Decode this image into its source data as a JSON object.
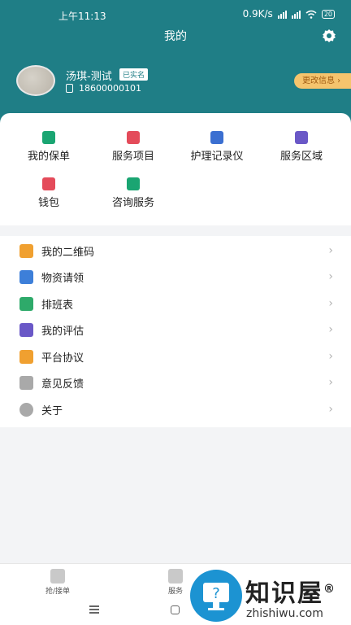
{
  "status": {
    "time": "上午11:13",
    "speed": "0.9K/s",
    "battery": "20"
  },
  "header": {
    "title": "我的"
  },
  "profile": {
    "name": "汤琪-测试",
    "badge": "已实名",
    "phone": "18600000101",
    "edit_label": "更改信息"
  },
  "services": [
    {
      "label": "我的保单",
      "icon": "policy-icon",
      "color": "#1aa572"
    },
    {
      "label": "服务项目",
      "icon": "service-items-icon",
      "color": "#e44b5a"
    },
    {
      "label": "护理记录仪",
      "icon": "recorder-icon",
      "color": "#3b6fd1"
    },
    {
      "label": "服务区域",
      "icon": "map-pin-icon",
      "color": "#6a58c7"
    },
    {
      "label": "钱包",
      "icon": "wallet-icon",
      "color": "#e44b5a"
    },
    {
      "label": "咨询服务",
      "icon": "chat-icon",
      "color": "#1aa572"
    }
  ],
  "menu": [
    {
      "label": "我的二维码",
      "icon": "qrcode-icon",
      "color": "#f0a030"
    },
    {
      "label": "物资请领",
      "icon": "medkit-icon",
      "color": "#3d7fd9"
    },
    {
      "label": "排班表",
      "icon": "calendar-icon",
      "color": "#2eaa6a"
    },
    {
      "label": "我的评估",
      "icon": "evaluate-icon",
      "color": "#6a58c7"
    },
    {
      "label": "平台协议",
      "icon": "agreement-icon",
      "color": "#f0a030"
    },
    {
      "label": "意见反馈",
      "icon": "feedback-icon",
      "color": "#a9a9a9"
    },
    {
      "label": "关于",
      "icon": "info-icon",
      "color": "#a9a9a9"
    }
  ],
  "tabbar": {
    "tab1": "抢/接单",
    "tab2": "服务"
  },
  "watermark": {
    "title": "知识屋",
    "reg": "®",
    "url": "zhishiwu.com"
  }
}
